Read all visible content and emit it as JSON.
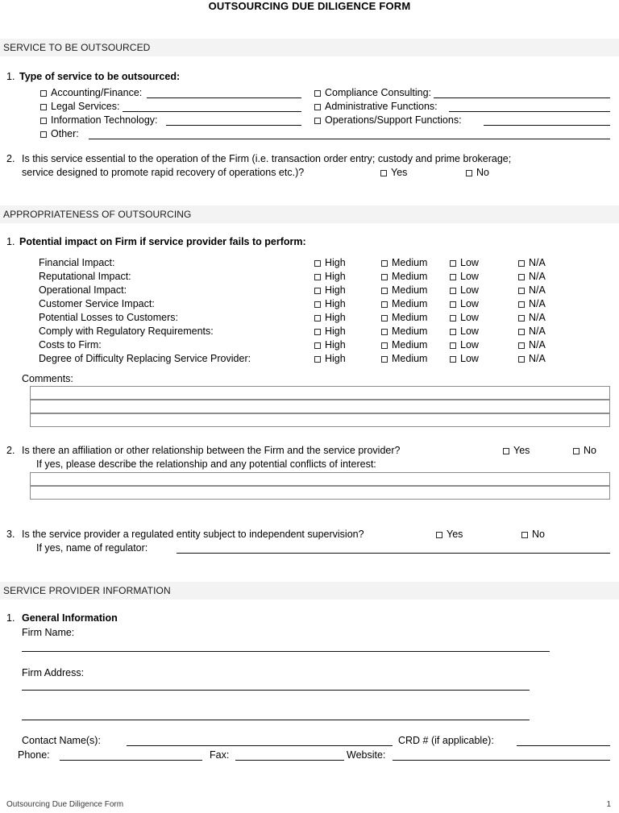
{
  "document": {
    "title": "OUTSOURCING DUE DILIGENCE FORM",
    "footer_label": "Outsourcing Due Diligence Form",
    "page_number": "1"
  },
  "section1": {
    "header": "SERVICE TO BE OUTSOURCED",
    "q1": {
      "number": "1.",
      "text": "Type of service to be outsourced:",
      "left_options": [
        "Accounting/Finance:",
        "Legal Services:",
        "Information Technology:",
        "Other:"
      ],
      "right_options": [
        "Compliance Consulting:",
        "Administrative Functions:",
        "Operations/Support Functions:"
      ]
    },
    "q2": {
      "number": "2.",
      "line1": "Is this service essential to the operation of the Firm (i.e. transaction order entry; custody and prime brokerage;",
      "line2": "service designed to promote rapid recovery of operations etc.)?",
      "yes": "Yes",
      "no": "No"
    }
  },
  "section2": {
    "header": "APPROPRIATENESS OF OUTSOURCING",
    "q1": {
      "number": "1.",
      "text": "Potential impact on Firm if service provider fails to perform:",
      "columns": [
        "High",
        "Medium",
        "Low",
        "N/A"
      ],
      "rows": [
        "Financial Impact:",
        "Reputational Impact:",
        "Operational Impact:",
        "Customer Service Impact:",
        "Potential Losses to Customers:",
        "Comply with Regulatory Requirements:",
        "Costs to Firm:",
        "Degree of Difficulty Replacing Service Provider:"
      ],
      "comments_label": "Comments:",
      "comments_rows": 3
    },
    "q2": {
      "number": "2.",
      "text": "Is there an affiliation or other relationship between the Firm and the service provider?",
      "yes": "Yes",
      "no": "No",
      "followup": "If yes, please describe the relationship and any potential conflicts of interest:",
      "answer_rows": 2
    },
    "q3": {
      "number": "3.",
      "text": "Is the service provider a regulated entity subject to independent supervision?",
      "yes": "Yes",
      "no": "No",
      "followup": "If yes, name of regulator:"
    }
  },
  "section3": {
    "header": "SERVICE PROVIDER INFORMATION",
    "q1": {
      "number": "1.",
      "text": "General Information",
      "firm_name_label": "Firm Name:",
      "firm_address_label": "Firm Address:",
      "contact_label": "Contact Name(s):",
      "crd_label": "CRD # (if applicable):",
      "phone_label": "Phone:",
      "fax_label": "Fax:",
      "website_label": "Website:"
    }
  }
}
